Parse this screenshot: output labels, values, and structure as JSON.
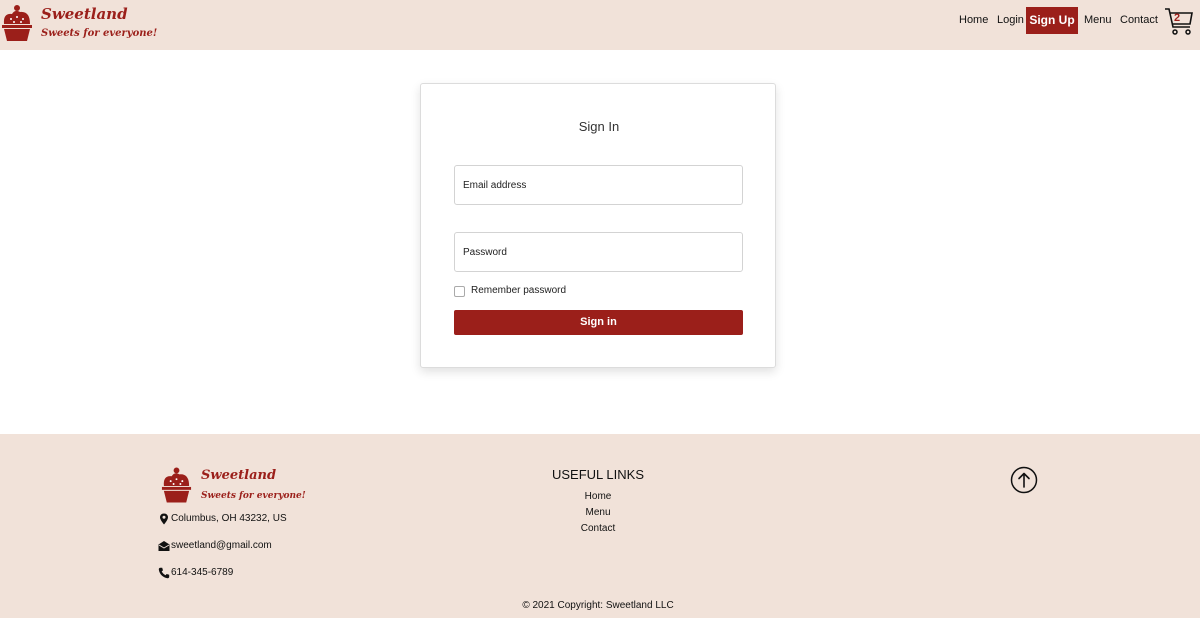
{
  "brand": {
    "name": "Sweetland",
    "tagline": "Sweets for everyone!",
    "color": "#9b1f1a",
    "icon": "cupcake-icon"
  },
  "nav": {
    "home": "Home",
    "login": "Login",
    "signup": "Sign Up",
    "menu": "Menu",
    "contact": "Contact",
    "cart_count": "2",
    "cart_icon": "shopping-cart-icon"
  },
  "signin": {
    "title": "Sign In",
    "email_placeholder": "Email address",
    "email_value": "",
    "password_placeholder": "Password",
    "password_value": "",
    "remember_label": "Remember password",
    "remember_checked": false,
    "button_label": "Sign in"
  },
  "footer": {
    "brand_name": "Sweetland",
    "brand_tagline": "Sweets for everyone!",
    "address": "Columbus, OH 43232, US",
    "email": "sweetland@gmail.com",
    "phone": "614-345-6789",
    "links_title": "USEFUL LINKS",
    "links": [
      "Home",
      "Menu",
      "Contact"
    ],
    "copyright": "© 2021 Copyright: Sweetland LLC",
    "icons": [
      "map-pin-icon",
      "envelope-icon",
      "phone-icon",
      "arrow-up-circle-icon"
    ]
  },
  "colors": {
    "header_bg": "#f1e2d9",
    "accent": "#9b1f1a"
  }
}
